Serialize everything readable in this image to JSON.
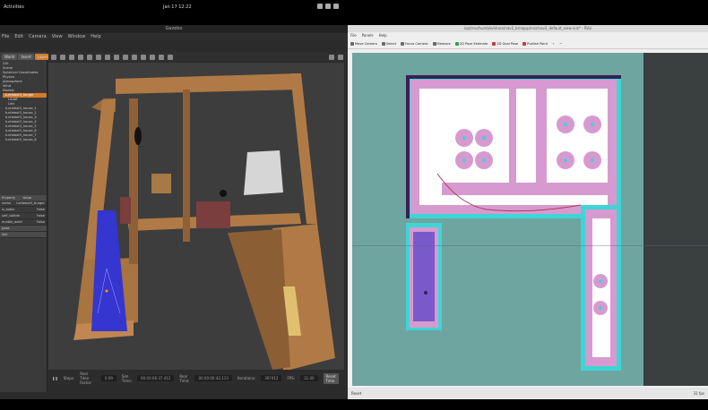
{
  "system_bar": {
    "activities": "Activities",
    "clock": "Jan 17  12:22"
  },
  "gazebo": {
    "title": "Gazebo",
    "menu": [
      "File",
      "Edit",
      "Camera",
      "View",
      "Window",
      "Help"
    ],
    "tabs": [
      "World",
      "Insert",
      "Layers"
    ],
    "tree": [
      "GUI",
      "Scene",
      "Spherical Coordinates",
      "Physics",
      "Atmosphere",
      "Wind",
      "Models",
      "turtlebot3_burger",
      "LiDAR",
      "Link",
      "turtlebot3_house_1",
      "turtlebot3_house_2",
      "turtlebot3_house_3",
      "turtlebot3_house_4",
      "turtlebot3_house_5",
      "turtlebot3_house_6",
      "turtlebot3_house_7",
      "turtlebot3_house_8"
    ],
    "props_header": [
      "Property",
      "Value"
    ],
    "props": [
      {
        "k": "name",
        "v": "turtlebot3_burger"
      },
      {
        "k": "is_static",
        "v": "False"
      },
      {
        "k": "self_collide",
        "v": "False"
      },
      {
        "k": "enable_wind",
        "v": "False"
      },
      {
        "k": "pose",
        "v": ""
      },
      {
        "k": "link",
        "v": ""
      }
    ],
    "status": {
      "steps_label": "Steps:",
      "rtf_label": "Real Time Factor:",
      "rtf": "0.99",
      "sim_label": "Sim Time:",
      "sim": "00:00:06:37.412",
      "real_label": "Real Time:",
      "real": "00:00:06:42.113",
      "iter_label": "Iterations:",
      "iter": "397412",
      "fps_label": "FPS:",
      "fps": "31.00",
      "reset": "Reset Time"
    }
  },
  "rviz": {
    "title": "/opt/ros/humble/share/nav2_bringup/rviz/nav2_default_view.rviz* - RViz",
    "menu": [
      "File",
      "Panels",
      "Help"
    ],
    "tools": [
      {
        "label": "Move Camera",
        "color": "#6a6a6a"
      },
      {
        "label": "Select",
        "color": "#6a6a6a"
      },
      {
        "label": "Focus Camera",
        "color": "#6a6a6a"
      },
      {
        "label": "Measure",
        "color": "#6a6a6a"
      },
      {
        "label": "2D Pose Estimate",
        "color": "#2ea043"
      },
      {
        "label": "2D Goal Pose",
        "color": "#c43c3c"
      },
      {
        "label": "Publish Point",
        "color": "#c43c3c"
      }
    ],
    "status_left": "Reset",
    "status_right": "31 fps"
  },
  "colors": {
    "gazebo_bg": "#2b2b2b",
    "wall": "#b07a46",
    "floor": "#3d3d3d",
    "costmap_bg": "#6fa5a0",
    "inflation": "#d69ad0",
    "free": "#ffffff",
    "obstacle": "#3a1f52",
    "cyan": "#3fd5d5"
  }
}
